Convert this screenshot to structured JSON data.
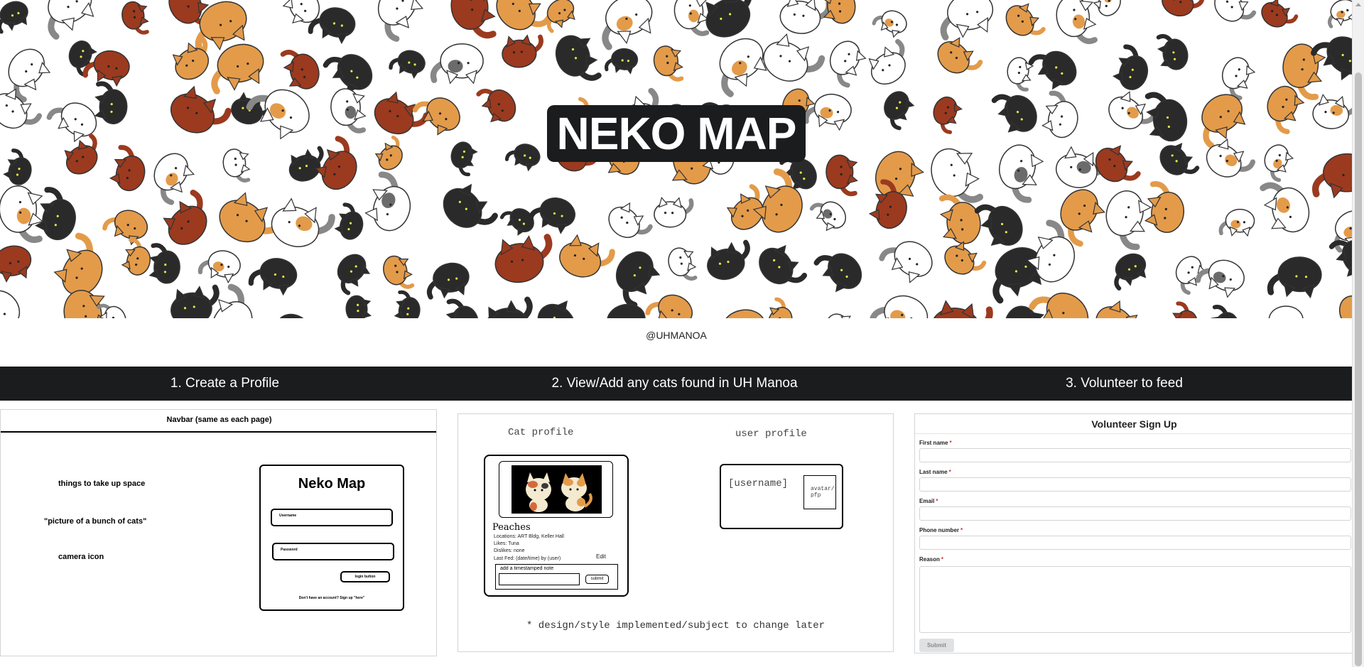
{
  "hero": {
    "title": "NEKO MAP",
    "handle": "@UHMANOA"
  },
  "steps": [
    "1. Create a Profile",
    "2. View/Add any cats found in UH Manoa",
    "3. Volunteer to feed"
  ],
  "mockup_profile": {
    "navbar_label": "Navbar (same as each page)",
    "hints": [
      "things to take up space",
      "\"picture of a bunch of cats\"",
      "camera icon"
    ],
    "login": {
      "title": "Neko Map",
      "username_label": "Username",
      "password_label": "Password",
      "button_label": "login button",
      "footer": "Don't have an account? Sign up \"here\""
    }
  },
  "mockup_cats": {
    "cat_heading": "Cat profile",
    "user_heading": "user profile",
    "cat": {
      "name": "Peaches",
      "locations": "Locations: ART Bldg, Keller Hall",
      "likes": "Likes: Tuna",
      "dislikes": "Dislikes: none",
      "last_fed": "Last Fed: (date/time) by (user)",
      "edit": "Edit",
      "note_label": "add a timestamped note",
      "submit": "submit"
    },
    "user": {
      "username": "[username]",
      "avatar": "avatar/ pfp"
    },
    "footnote": "* design/style implemented/subject to change later"
  },
  "form": {
    "title": "Volunteer Sign Up",
    "fields": [
      {
        "label": "First name"
      },
      {
        "label": "Last name"
      },
      {
        "label": "Email"
      },
      {
        "label": "Phone number"
      },
      {
        "label": "Reason"
      }
    ],
    "required_mark": "*",
    "submit": "Submit"
  },
  "colors": {
    "dark": "#1b1c1d",
    "cat_orange": "#e39b4a",
    "cat_brown": "#9b3a1f",
    "cat_black": "#2a2a2a",
    "cat_gray": "#6b6b6b",
    "required": "#db2828"
  }
}
